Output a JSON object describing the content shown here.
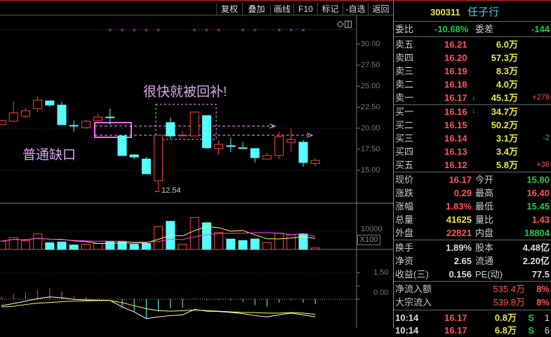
{
  "toolbar": {
    "buttons": [
      "复权",
      "叠加",
      "画线",
      "F10",
      "标记",
      "-自选",
      "返回"
    ]
  },
  "chart_icons": {
    "diamond": "◇",
    "panel": "◫"
  },
  "annotations": {
    "gap_label": "普通缺口",
    "filled_label": "很快就被回补!",
    "low_label": "←12.54"
  },
  "price_axis": [
    "30.00",
    "27.50",
    "25.00",
    "22.50",
    "20.00",
    "17.50",
    "15.00"
  ],
  "volume_axis": {
    "label": "10000",
    "unit": "X100"
  },
  "macd_axis": [
    "1.50",
    "0.00"
  ],
  "chart_data": {
    "type": "candlestick",
    "ylim": [
      12.5,
      30
    ],
    "candles": [
      [
        20.42,
        20.92,
        21.0,
        20.3
      ],
      [
        20.83,
        21.83,
        23.17,
        20.83
      ],
      [
        21.42,
        22.08,
        22.42,
        21.25
      ],
      [
        22.33,
        23.33,
        23.75,
        21.92
      ],
      [
        23.25,
        22.75,
        23.3,
        22.58
      ],
      [
        22.75,
        20.42,
        23.17,
        20.42
      ],
      [
        20.33,
        20.33,
        20.92,
        19.58
      ],
      [
        20.08,
        20.83,
        21.0,
        19.92
      ],
      [
        20.92,
        21.33,
        21.75,
        20.92
      ],
      [
        21.33,
        21.33,
        22.33,
        20.42
      ],
      [
        19.08,
        16.75,
        19.08,
        16.75
      ],
      [
        16.83,
        16.58,
        16.83,
        16.33
      ],
      [
        16.33,
        14.58,
        16.58,
        14.58
      ],
      [
        13.75,
        19.17,
        19.17,
        12.54
      ],
      [
        20.67,
        19.08,
        21.25,
        18.75
      ],
      [
        19.17,
        19.17,
        19.67,
        19.17
      ],
      [
        19.08,
        21.92,
        21.92,
        19.08
      ],
      [
        21.5,
        17.67,
        21.5,
        17.58
      ],
      [
        17.58,
        18.08,
        18.58,
        16.83
      ],
      [
        17.92,
        17.83,
        18.83,
        17.17
      ],
      [
        17.67,
        17.67,
        18.33,
        17.67
      ],
      [
        17.58,
        16.5,
        17.58,
        15.92
      ],
      [
        16.33,
        16.75,
        17.08,
        16.33
      ],
      [
        16.75,
        19.0,
        19.58,
        16.33
      ],
      [
        18.33,
        18.67,
        20.0,
        17.17
      ],
      [
        18.33,
        15.92,
        18.58,
        15.42
      ],
      [
        15.8,
        16.17,
        16.4,
        15.45
      ]
    ],
    "volume": [
      4460,
      6400,
      4800,
      8400,
      3600,
      4000,
      2400,
      2800,
      3200,
      4400,
      4400,
      2800,
      3200,
      12400,
      15200,
      2800,
      17200,
      14400,
      9200,
      5600,
      4800,
      5600,
      3600,
      8800,
      8000,
      8400,
      800
    ],
    "macd_dif": [
      -0.37,
      -0.25,
      -0.11,
      0.03,
      0.13,
      0.08,
      -0.01,
      -0.04,
      -0.06,
      -0.07,
      -0.44,
      -0.72,
      -1.1,
      -1.0,
      -0.93,
      -0.89,
      -0.58,
      -0.68,
      -0.7,
      -0.75,
      -0.82,
      -0.93,
      -1.0,
      -0.89,
      -0.79,
      -0.89,
      -1.0
    ],
    "macd_dea": [
      -0.44,
      -0.4,
      -0.3,
      -0.23,
      -0.19,
      -0.14,
      -0.11,
      -0.1,
      -0.08,
      -0.08,
      -0.2,
      -0.37,
      -0.54,
      -0.65,
      -0.68,
      -0.65,
      -0.61,
      -0.65,
      -0.68,
      -0.72,
      -0.75,
      -0.76,
      -0.79,
      -0.79,
      -0.76,
      -0.79,
      -0.86
    ],
    "markers": [
      9,
      10,
      11,
      12,
      13,
      16,
      17,
      18,
      20,
      21,
      23,
      24,
      25
    ]
  },
  "quote": {
    "code": "300311",
    "name": "任子行",
    "wb_label": "委比",
    "wb": "-10.68%",
    "wc_label": "委差",
    "wc": "-144",
    "asks": [
      {
        "label": "卖五",
        "price": "16.21",
        "vol": "6.0万",
        "chg": ""
      },
      {
        "label": "卖四",
        "price": "16.20",
        "vol": "57.3万",
        "chg": ""
      },
      {
        "label": "卖三",
        "price": "16.19",
        "vol": "8.3万",
        "chg": ""
      },
      {
        "label": "卖二",
        "price": "16.18",
        "vol": "4.0万",
        "chg": ""
      },
      {
        "label": "卖一",
        "price": "16.17",
        "vol": "45.1万",
        "chg": "+279"
      }
    ],
    "bids": [
      {
        "label": "买一",
        "price": "16.16",
        "vol": "34.7万",
        "chg": ""
      },
      {
        "label": "买二",
        "price": "16.15",
        "vol": "50.2万",
        "chg": ""
      },
      {
        "label": "买三",
        "price": "16.14",
        "vol": "3.1万",
        "chg": "-2"
      },
      {
        "label": "买四",
        "price": "16.13",
        "vol": "3.4万",
        "chg": ""
      },
      {
        "label": "买五",
        "price": "16.12",
        "vol": "5.8万",
        "chg": "+36"
      }
    ],
    "stats": [
      {
        "l1": "现价",
        "v1": "16.17",
        "l2": "今开",
        "v2": "15.80"
      },
      {
        "l1": "涨跌",
        "v1": "0.29",
        "l2": "最高",
        "v2": "16.40"
      },
      {
        "l1": "涨幅",
        "v1": "1.83%",
        "l2": "最低",
        "v2": "15.45"
      },
      {
        "l1": "总量",
        "v1": "41625",
        "l2": "量比",
        "v2": "1.43"
      },
      {
        "l1": "外盘",
        "v1": "22821",
        "l2": "内盘",
        "v2": "18804"
      }
    ],
    "fund": [
      {
        "l1": "换手",
        "v1": "1.89%",
        "l2": "股本",
        "v2": "4.48亿"
      },
      {
        "l1": "净资",
        "v1": "2.65",
        "l2": "流通",
        "v2": "2.20亿"
      },
      {
        "l1": "收益(三)",
        "v1": "0.156",
        "l2": "PE(动)",
        "v2": "77.5"
      }
    ],
    "flow": [
      {
        "label": "净流入额",
        "value": "535.4万",
        "pct": "8%"
      },
      {
        "label": "大宗流入",
        "value": "539.8万",
        "pct": "8%"
      }
    ],
    "ticks": [
      {
        "time": "10:14",
        "price": "16.17",
        "vol": "0.8万",
        "side": "S",
        "n": "1"
      },
      {
        "time": "10:14",
        "price": "16.17",
        "vol": "6.8万",
        "side": "S",
        "n": "6"
      }
    ]
  }
}
